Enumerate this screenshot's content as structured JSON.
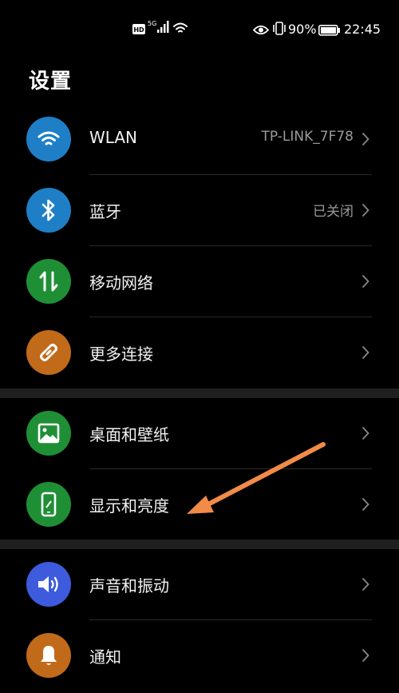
{
  "status_bar": {
    "hd": "HD",
    "network": "5G",
    "battery": "90%",
    "time": "22:45"
  },
  "page": {
    "title": "设置"
  },
  "groups": [
    {
      "items": [
        {
          "label": "WLAN",
          "value": "TP-LINK_7F78",
          "icon": "wifi-icon",
          "color": "#1e7fc7"
        },
        {
          "label": "蓝牙",
          "value": "已关闭",
          "icon": "bluetooth-icon",
          "color": "#1e7fc7"
        },
        {
          "label": "移动网络",
          "value": "",
          "icon": "mobile-data-icon",
          "color": "#1f8f36"
        },
        {
          "label": "更多连接",
          "value": "",
          "icon": "link-icon",
          "color": "#c06a1a"
        }
      ]
    },
    {
      "items": [
        {
          "label": "桌面和壁纸",
          "value": "",
          "icon": "image-icon",
          "color": "#1f8f36"
        },
        {
          "label": "显示和亮度",
          "value": "",
          "icon": "phone-brightness-icon",
          "color": "#1f8f36"
        }
      ]
    },
    {
      "items": [
        {
          "label": "声音和振动",
          "value": "",
          "icon": "speaker-icon",
          "color": "#3d5bdc"
        },
        {
          "label": "通知",
          "value": "",
          "icon": "bell-icon",
          "color": "#c06a1a"
        }
      ]
    }
  ],
  "annotation": {
    "color": "#f28a48",
    "icon": "annotation-arrow"
  }
}
